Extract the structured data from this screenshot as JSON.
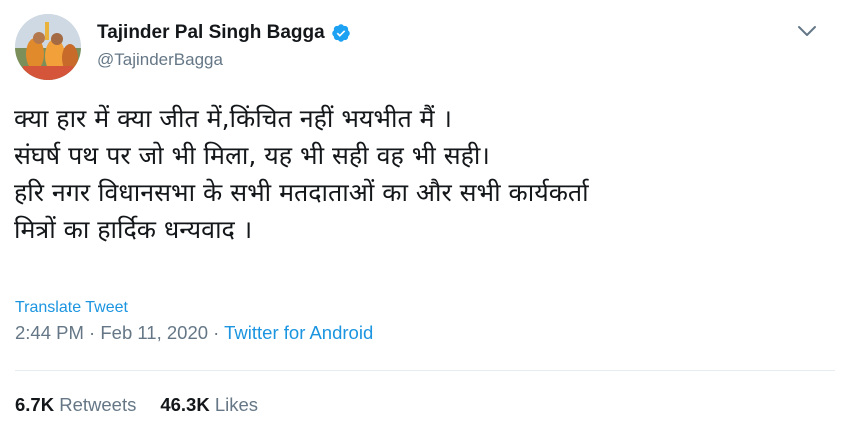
{
  "author": {
    "display_name": "Tajinder Pal Singh Bagga",
    "handle": "@TajinderBagga"
  },
  "tweet": {
    "lines": [
      "क्या हार में क्या जीत में,किंचित नहीं भयभीत मैं ।",
      "संघर्ष पथ पर जो भी मिला, यह भी सही वह भी सही।",
      "हरि नगर विधानसभा के सभी मतदाताओं का और सभी कार्यकर्ता",
      "मित्रों का हार्दिक धन्यवाद ।"
    ],
    "translate_label": "Translate Tweet",
    "time": "2:44 PM",
    "date": "Feb 11, 2020",
    "separator": " · ",
    "source": "Twitter for Android"
  },
  "stats": {
    "retweets_count": "6.7K",
    "retweets_label": "Retweets",
    "likes_count": "46.3K",
    "likes_label": "Likes"
  },
  "colors": {
    "link": "#1b95e0",
    "muted": "#657786",
    "text": "#14171a",
    "verified": "#1da1f2",
    "divider": "#e6ecf0"
  },
  "icons": {
    "verified": "verified-badge-icon",
    "menu": "chevron-down-icon"
  }
}
